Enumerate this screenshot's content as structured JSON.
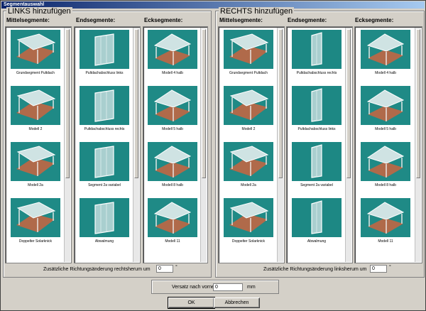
{
  "window": {
    "title": "Segmentauswahl"
  },
  "left": {
    "title": "LINKS hinzufügen",
    "columns": [
      {
        "label": "Mittelsegmente:",
        "items": [
          "Grundsegment Pultdach",
          "Modell 2",
          "Modell 2a",
          "Doppelter Solarknick"
        ]
      },
      {
        "label": "Endsegmente:",
        "items": [
          "Pultdachabschluss links",
          "Pultdachabschluss rechts",
          "Segment 2a variabel",
          "Abwalmung"
        ]
      },
      {
        "label": "Ecksegmente:",
        "items": [
          "Modell 4 halb",
          "Modell 5 halb",
          "Modell 8 halb",
          "Modell 11"
        ]
      }
    ],
    "rotation_label": "Zusätzliche Richtungsänderung rechtsherum um",
    "rotation_value": "0",
    "rotation_unit": "°"
  },
  "right": {
    "title": "RECHTS hinzufügen",
    "columns": [
      {
        "label": "Mittelsegmente:",
        "items": [
          "Grundsegment Pultdach",
          "Modell 2",
          "Modell 2a",
          "Doppelter Solarknick"
        ]
      },
      {
        "label": "Endsegmente:",
        "items": [
          "Pultdachabschluss rechts",
          "Pultdachabschluss links",
          "Segment 2a variabel",
          "Abwalmung"
        ]
      },
      {
        "label": "Ecksegmente:",
        "items": [
          "Modell 4 halb",
          "Modell 5 halb",
          "Modell 8 halb",
          "Modell 11"
        ]
      }
    ],
    "rotation_label": "Zusätzliche Richtungsänderung linksherum um",
    "rotation_value": "0",
    "rotation_unit": "°"
  },
  "offset": {
    "label": "Versatz nach vorne:",
    "value": "0",
    "unit": "mm"
  },
  "buttons": {
    "ok": "OK",
    "cancel": "Abbrechen"
  }
}
